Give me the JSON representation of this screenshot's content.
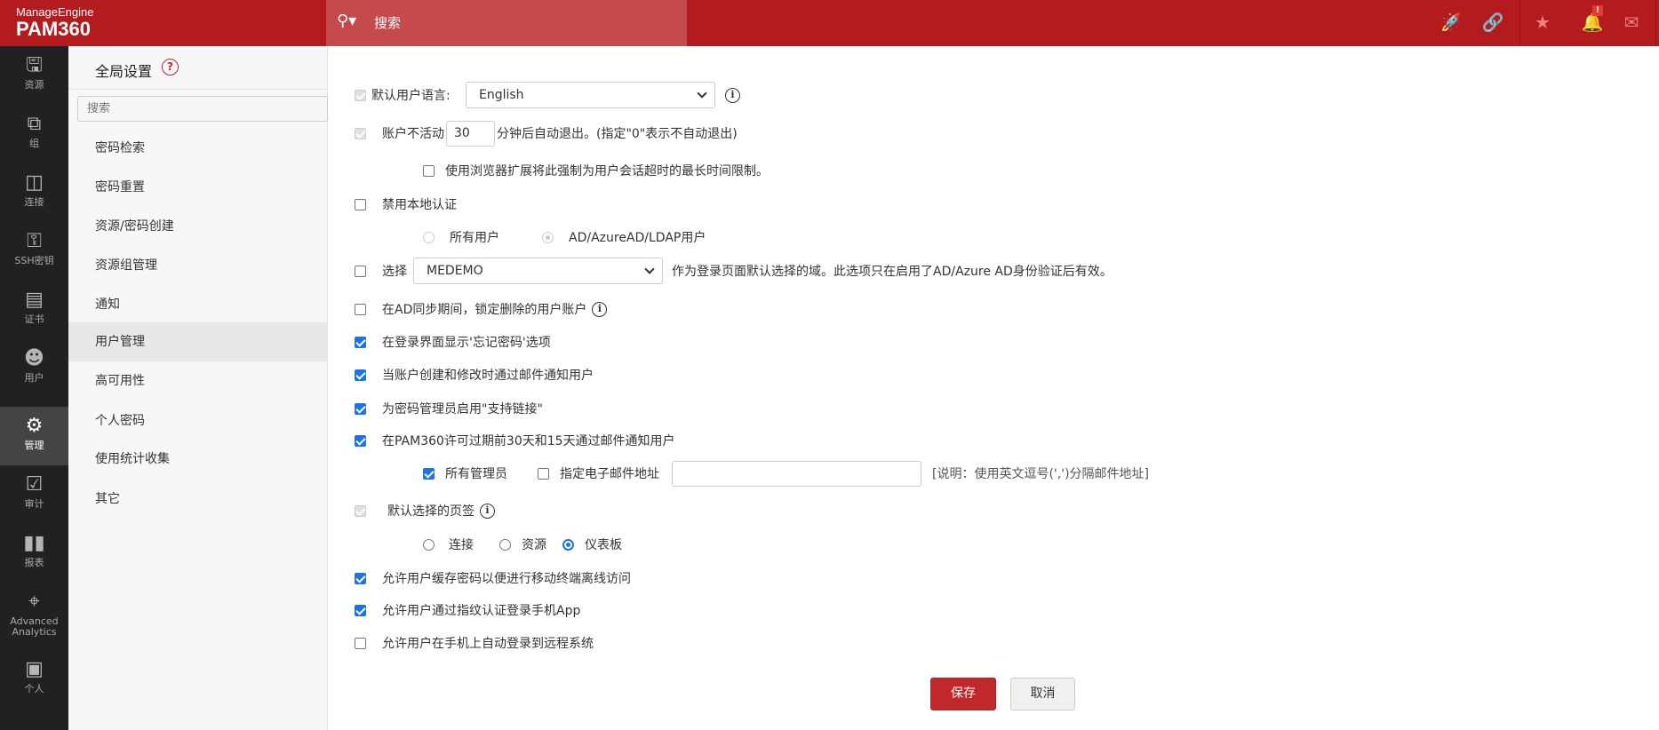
{
  "header": {
    "brand_top": "ManageEngine",
    "brand_product": "PAM360",
    "search_placeholder": "搜索",
    "notification_badge": "!"
  },
  "nav": [
    {
      "label": "资源",
      "icon": "monitor-icon"
    },
    {
      "label": "组",
      "icon": "group-icon"
    },
    {
      "label": "连接",
      "icon": "connection-icon"
    },
    {
      "label": "SSH密钥",
      "icon": "ssh-key-icon"
    },
    {
      "label": "证书",
      "icon": "certificate-icon"
    },
    {
      "label": "用户",
      "icon": "user-icon"
    },
    {
      "label": "管理",
      "icon": "gear-icon",
      "active": true
    },
    {
      "label": "审计",
      "icon": "audit-icon"
    },
    {
      "label": "报表",
      "icon": "report-icon"
    },
    {
      "label": "Advanced Analytics",
      "icon": "analytics-icon"
    },
    {
      "label": "个人",
      "icon": "personal-icon"
    }
  ],
  "panel": {
    "title": "全局设置",
    "search_placeholder": "搜索",
    "items": [
      "密码检索",
      "密码重置",
      "资源/密码创建",
      "资源组管理",
      "通知",
      "用户管理",
      "高可用性",
      "个人密码",
      "使用统计收集",
      "其它"
    ],
    "active": "用户管理"
  },
  "form": {
    "default_language_label": "默认用户语言:",
    "default_language_value": "English",
    "inactive_prefix": "账户不活动",
    "inactive_minutes": "30",
    "inactive_suffix": "分钟后自动退出。(指定\"0\"表示不自动退出)",
    "browser_ext_label": "使用浏览器扩展将此强制为用户会话超时的最长时间限制。",
    "disable_local_auth": "禁用本地认证",
    "radio_all_users": "所有用户",
    "radio_ad_users": "AD/AzureAD/LDAP用户",
    "select_label": "选择",
    "domain_value": "MEDEMO",
    "domain_desc": "作为登录页面默认选择的域。此选项只在启用了AD/Azure AD身份验证后有效。",
    "lock_deleted": "在AD同步期间，锁定删除的用户账户",
    "show_forgot": "在登录界面显示'忘记密码'选项",
    "notify_create": "当账户创建和修改时通过邮件通知用户",
    "support_link": "为密码管理员启用\"支持链接\"",
    "license_notify": "在PAM360许可过期前30天和15天通过邮件通知用户",
    "all_admins": "所有管理员",
    "specify_email": "指定电子邮件地址",
    "email_value": "",
    "email_note": "[说明：使用英文逗号(',')分隔邮件地址]",
    "default_tab": "默认选择的页签",
    "tab_connect": "连接",
    "tab_resource": "资源",
    "tab_dashboard": "仪表板",
    "cache_password": "允许用户缓存密码以便进行移动终端离线访问",
    "fingerprint": "允许用户通过指纹认证登录手机App",
    "auto_login": "允许用户在手机上自动登录到远程系统",
    "save": "保存",
    "cancel": "取消"
  },
  "colors": {
    "brand": "#b31b1f",
    "search_bg": "#c54a4c",
    "nav_bg": "#212121",
    "accent": "#1a73e8",
    "save_bg": "#c0282b"
  }
}
